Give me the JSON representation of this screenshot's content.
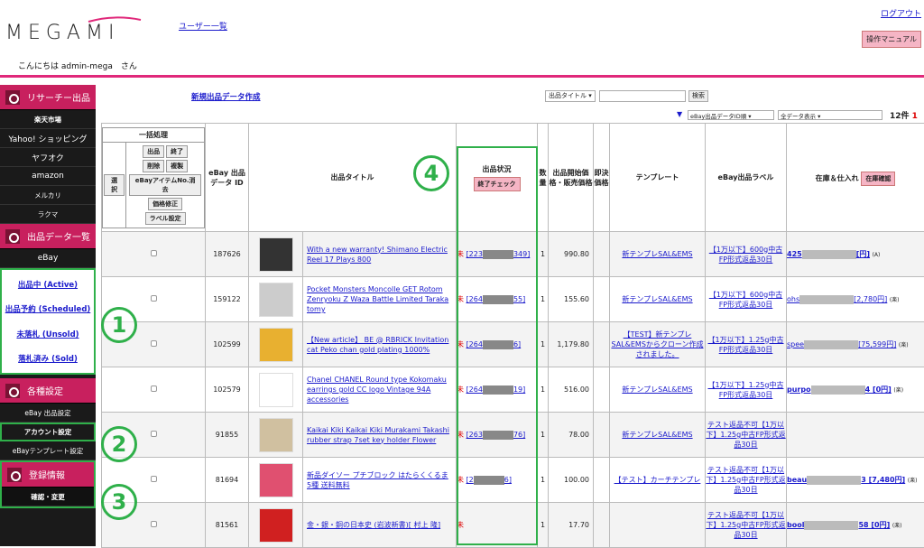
{
  "header": {
    "logo_text": "MEGAMI",
    "user_list": "ユーザー一覧",
    "logout": "ログアウト",
    "manual": "操作マニュアル",
    "greeting": "こんにちは admin-mega　さん"
  },
  "sidebar": {
    "research": "リサーチー出品",
    "research_items": [
      "楽天市場",
      "Yahoo! ショッピング",
      "ヤフオク",
      "amazon",
      "メルカリ",
      "ラクマ"
    ],
    "listing": "出品データ一覧",
    "listing_sub": "eBay",
    "status_links": [
      "出品中 (Active)",
      "出品予約 (Scheduled)",
      "未落札 (Unsold)",
      "落札済み (Sold)"
    ],
    "settings": "各種設定",
    "settings_items": [
      "eBay 出品設定",
      "アカウント設定",
      "eBayテンプレート設定"
    ],
    "registration": "登録情報",
    "registration_items": [
      "確認・変更"
    ]
  },
  "main": {
    "new_link": "新規出品データ作成",
    "search_select": "出品タイトル",
    "search_button": "検索",
    "sort_select": "eBay出品データID順",
    "display_select": "全データ表示",
    "count": "12件",
    "count_page": "1"
  },
  "batch": {
    "title": "一括処理",
    "select": "選択",
    "buttons": [
      "出品",
      "終了",
      "削除",
      "複製",
      "eBayアイテムNo.消去",
      "価格修正",
      "ラベル設定"
    ]
  },
  "columns": [
    "eBay 出品データ ID",
    "出品タイトル",
    "出品状況",
    "数量",
    "出品開始価格・販売価格",
    "即決価格",
    "テンプレート",
    "eBay出品ラベル",
    "在庫＆仕入れ"
  ],
  "status_check": "終了チェック",
  "stock_check": "在庫確認",
  "rows": [
    {
      "id": "187626",
      "title": "With a new warranty! Shimano Electric Reel 17 Plays 800",
      "status_mark": "未",
      "status_pre": "[223",
      "status_post": "349]",
      "qty": "1",
      "price": "990.80",
      "template": "新テンプレSAL&EMS",
      "label": "【1万以下】600g中古FP形式返品30日",
      "stock": "425",
      "stock_tail": "[円]",
      "stock_note": "(A)"
    },
    {
      "id": "159122",
      "title": "Pocket Monsters Moncolle GET Rotom Zenryoku Z Waza Battle Limited Taraka tomy",
      "status_mark": "未",
      "status_pre": "[264",
      "status_post": "55]",
      "qty": "1",
      "price": "155.60",
      "template": "新テンプレSAL&EMS",
      "label": "【1万以下】600g中古FP形式返品30日",
      "stock": "ohs",
      "stock_tail": "[2,780円]",
      "stock_note": "(楽)"
    },
    {
      "id": "102599",
      "title": "【New article】 BE @ RBRICK Invitation cat Peko chan gold plating 1000%",
      "status_mark": "未",
      "status_pre": "[264",
      "status_post": "6]",
      "qty": "1",
      "price": "1,179.80",
      "template": "【TEST】新テンプレSAL&EMSからクローン作成されました。",
      "label": "【1万以下】1.25g中古FP形式返品30日",
      "stock": "spee",
      "stock_tail": "[75,599円]",
      "stock_note": "(楽)"
    },
    {
      "id": "102579",
      "title": "Chanel CHANEL Round type Kokomaku earrings gold CC logo Vintage 94A accessories",
      "status_mark": "未",
      "status_pre": "[264",
      "status_post": "19]",
      "qty": "1",
      "price": "516.00",
      "template": "新テンプレSAL&EMS",
      "label": "【1万以下】1.25g中古FP形式返品30日",
      "stock": "purpo",
      "stock_tail": "4 [0円]",
      "stock_note": "(楽)"
    },
    {
      "id": "91855",
      "title": "Kaikai Kiki Kaikai Kiki Murakami Takashi rubber strap 7set key holder Flower",
      "status_mark": "未",
      "status_pre": "[263",
      "status_post": "76]",
      "qty": "1",
      "price": "78.00",
      "template": "新テンプレSAL&EMS",
      "label": "テスト返品不可【1万以下】1.25g中古FP形式返品30日",
      "stock": "",
      "stock_tail": "",
      "stock_note": ""
    },
    {
      "id": "81694",
      "title": "新品ダイソー プチブロック はたらくくるま5種 送料無料",
      "status_mark": "未",
      "status_pre": "[2",
      "status_post": "6]",
      "qty": "1",
      "price": "100.00",
      "template": "【テスト】カーチテンプレ",
      "label": "テスト返品不可【1万以下】1.25g中古FP形式返品30日",
      "stock": "beau",
      "stock_tail": "3 [7,480円]",
      "stock_note": "(楽)"
    },
    {
      "id": "81561",
      "title": "金・銀・銅の日本史 (岩波新書)[ 村上 隆]",
      "status_mark": "未",
      "status_pre": "",
      "status_post": "",
      "qty": "1",
      "price": "17.70",
      "template": "",
      "label": "テスト返品不可【1万以下】1.25g中古FP形式返品30日",
      "stock": "bool",
      "stock_tail": "58 [0円]",
      "stock_note": "(楽)"
    }
  ],
  "annotations": [
    "1",
    "2",
    "3",
    "4"
  ]
}
